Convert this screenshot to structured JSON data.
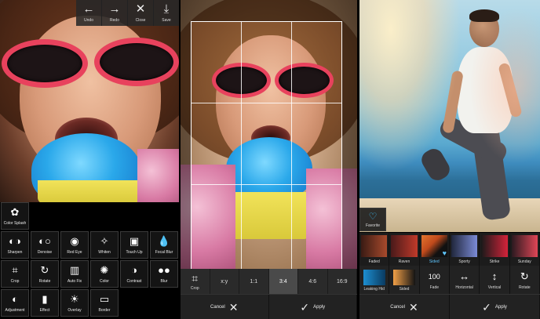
{
  "panel1": {
    "toolbar": [
      {
        "icon": "←",
        "label": "Undo",
        "name": "undo"
      },
      {
        "icon": "→",
        "label": "Redo",
        "name": "redo"
      },
      {
        "icon": "✕",
        "label": "Close",
        "name": "close"
      },
      {
        "icon": "⤓",
        "label": "Save",
        "name": "save"
      }
    ],
    "tools": [
      {
        "icon": "✿",
        "label": "Color Splash",
        "name": "color-splash"
      },
      {
        "icon": "◐◑",
        "label": "Sharpen",
        "name": "sharpen"
      },
      {
        "icon": "◐○",
        "label": "Denoise",
        "name": "denoise"
      },
      {
        "icon": "◉",
        "label": "Red Eye",
        "name": "red-eye"
      },
      {
        "icon": "✧",
        "label": "Whiten",
        "name": "whiten"
      },
      {
        "icon": "▣",
        "label": "Touch Up",
        "name": "touch-up"
      },
      {
        "icon": "💧",
        "label": "Focal Blur",
        "name": "focal-blur"
      },
      {
        "icon": "⌗",
        "label": "Crop",
        "name": "crop"
      },
      {
        "icon": "↻",
        "label": "Rotate",
        "name": "rotate"
      },
      {
        "icon": "▥",
        "label": "Auto Fix",
        "name": "auto-fix"
      },
      {
        "icon": "✺",
        "label": "Color",
        "name": "color"
      },
      {
        "icon": "◑",
        "label": "Contrast",
        "name": "contrast"
      },
      {
        "icon": "●●",
        "label": "Blur",
        "name": "blur"
      },
      {
        "icon": "◐",
        "label": "Adjustment",
        "name": "adjustment"
      },
      {
        "icon": "▮",
        "label": "Effect",
        "name": "effect"
      },
      {
        "icon": "☀",
        "label": "Overlay",
        "name": "overlay"
      },
      {
        "icon": "▭",
        "label": "Border",
        "name": "border"
      }
    ]
  },
  "panel2": {
    "ratios": [
      {
        "icon": "⌗",
        "label": "Crop",
        "name": "crop"
      },
      {
        "label": "x:y",
        "name": "x-y"
      },
      {
        "label": "1:1",
        "name": "1-1"
      },
      {
        "label": "3:4",
        "name": "3-4"
      },
      {
        "label": "4:6",
        "name": "4-6"
      },
      {
        "label": "16:9",
        "name": "16-9"
      }
    ],
    "selected_ratio": "3:4",
    "cancel_label": "Cancel",
    "apply_label": "Apply"
  },
  "panel3": {
    "favorite_label": "Favorite",
    "effects": [
      {
        "label": "Faded",
        "colors": [
          "#3a1b14",
          "#a84a2c"
        ]
      },
      {
        "label": "Raven",
        "colors": [
          "#4a1a1a",
          "#c03a2a"
        ]
      },
      {
        "label": "Sided",
        "colors": [
          "#e2752e",
          "#111111"
        ]
      },
      {
        "label": "Sporty",
        "colors": [
          "#20263b",
          "#7b8bd6"
        ]
      },
      {
        "label": "Strike",
        "colors": [
          "#1a1a1a",
          "#d4233a"
        ]
      },
      {
        "label": "Sunday",
        "colors": [
          "#2b1a20",
          "#e04656"
        ]
      }
    ],
    "selected_effect": "Sided",
    "tools": [
      {
        "label": "Leaking Hid",
        "name": "leaking-hid",
        "colors": [
          "#1d8fd1",
          "#0a3a60"
        ]
      },
      {
        "label": "Sided",
        "name": "sided",
        "colors": [
          "#f2a047",
          "#141414"
        ]
      },
      {
        "icon": "100",
        "label": "Fade",
        "name": "fade"
      },
      {
        "icon": "↔",
        "label": "Horizontal",
        "name": "horizontal"
      },
      {
        "icon": "↕",
        "label": "Vertical",
        "name": "vertical"
      },
      {
        "icon": "↻",
        "label": "Rotate",
        "name": "rotate"
      }
    ],
    "cancel_label": "Cancel",
    "apply_label": "Apply"
  }
}
